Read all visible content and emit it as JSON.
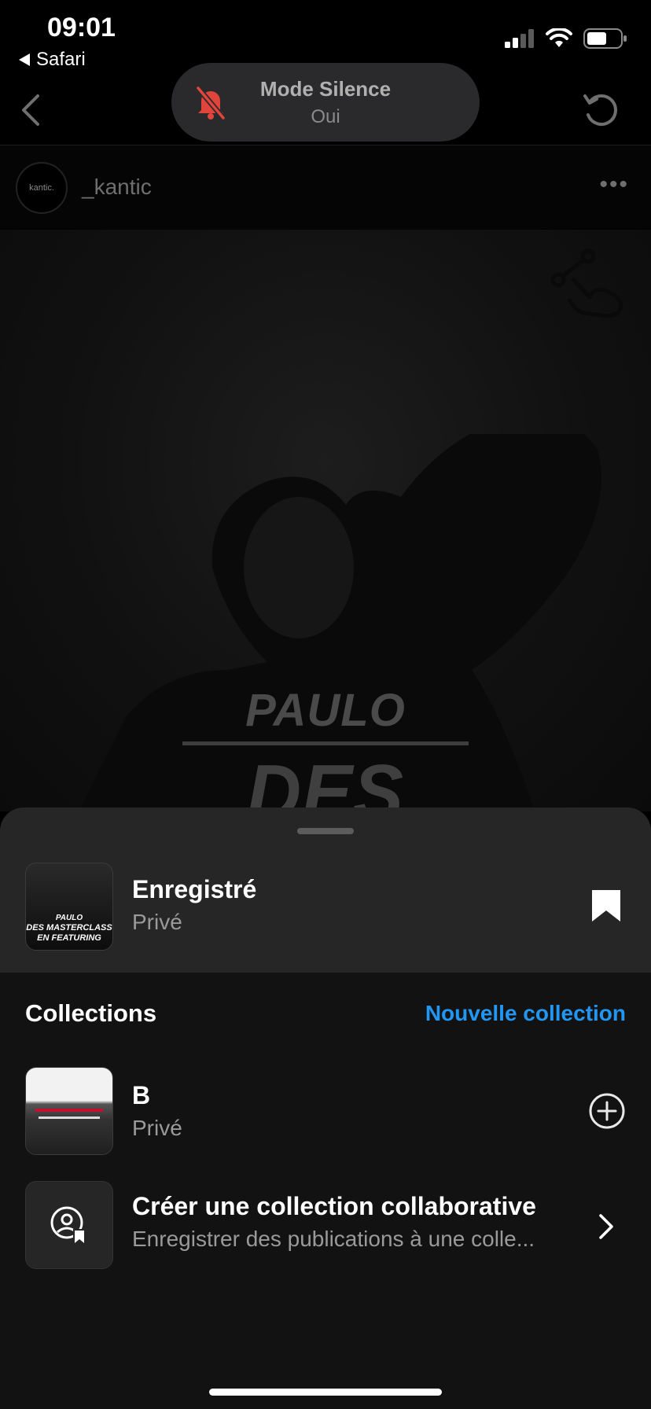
{
  "status_bar": {
    "time": "09:01",
    "back_app": "Safari"
  },
  "silence_banner": {
    "title": "Mode Silence",
    "subtitle": "Oui",
    "icon": "bell-slash-icon",
    "icon_color": "#e0443a"
  },
  "post": {
    "username": "_kantic",
    "avatar_text": "kantic.",
    "image": {
      "line1": "PAULO",
      "line2": "DES MASTERCLASS"
    }
  },
  "sheet": {
    "saved": {
      "title": "Enregistré",
      "subtitle": "Privé",
      "thumb_text": {
        "a": "PAULO",
        "b": "DES MASTERCLASS",
        "c": "EN FEATURING"
      }
    },
    "collections_header": "Collections",
    "new_collection_label": "Nouvelle collection",
    "collections": [
      {
        "title": "B",
        "subtitle": "Privé"
      }
    ],
    "collab": {
      "title": "Créer une collection collaborative",
      "subtitle": "Enregistrer des publications à une colle..."
    }
  },
  "colors": {
    "accent": "#2196f3",
    "sheet": "#121212",
    "sheet_top": "#262626"
  }
}
